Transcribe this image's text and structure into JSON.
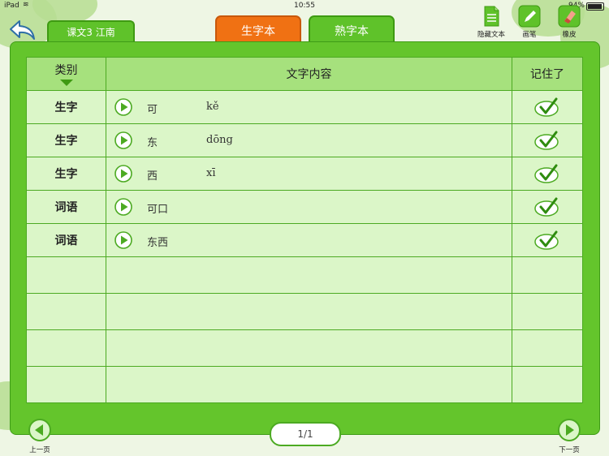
{
  "status_bar": {
    "device": "iPad",
    "time": "10:55",
    "battery": "94%",
    "battery_level": 0.94
  },
  "header": {
    "lesson_label": "课文3 江南",
    "tabs": [
      {
        "label": "生字本",
        "active": true
      },
      {
        "label": "熟字本",
        "active": false
      }
    ],
    "tools": [
      {
        "label": "隐藏文本",
        "icon": "document-icon"
      },
      {
        "label": "画笔",
        "icon": "pencil-icon"
      },
      {
        "label": "橡皮",
        "icon": "eraser-icon"
      }
    ]
  },
  "table": {
    "columns": [
      "类别",
      "文字内容",
      "记住了"
    ],
    "rows": [
      {
        "category": "生字",
        "word": "可",
        "pinyin": "kě",
        "remembered": true
      },
      {
        "category": "生字",
        "word": "东",
        "pinyin": "dōng",
        "remembered": true
      },
      {
        "category": "生字",
        "word": "西",
        "pinyin": "xī",
        "remembered": true
      },
      {
        "category": "词语",
        "word": "可口",
        "pinyin": "",
        "remembered": true
      },
      {
        "category": "词语",
        "word": "东西",
        "pinyin": "",
        "remembered": true
      },
      {
        "category": "",
        "word": "",
        "pinyin": "",
        "remembered": false
      },
      {
        "category": "",
        "word": "",
        "pinyin": "",
        "remembered": false
      },
      {
        "category": "",
        "word": "",
        "pinyin": "",
        "remembered": false
      },
      {
        "category": "",
        "word": "",
        "pinyin": "",
        "remembered": false
      }
    ]
  },
  "footer": {
    "page": "1/1",
    "prev_label": "上一页",
    "next_label": "下一页"
  },
  "colors": {
    "green": "#5fc22a",
    "orange": "#f07113",
    "light_green": "#dbf6c8",
    "header_green": "#a6e17d"
  }
}
